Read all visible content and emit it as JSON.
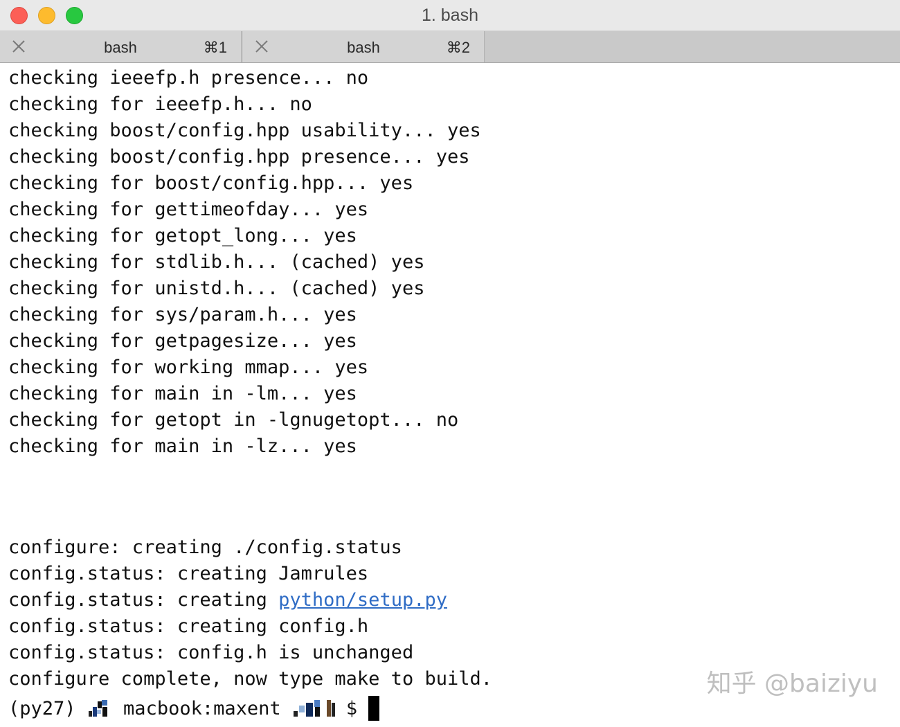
{
  "window": {
    "title": "1. bash"
  },
  "tabs": [
    {
      "label": "bash",
      "shortcut": "⌘1"
    },
    {
      "label": "bash",
      "shortcut": "⌘2"
    }
  ],
  "terminal": {
    "lines": [
      "checking ieeefp.h presence... no",
      "checking for ieeefp.h... no",
      "checking boost/config.hpp usability... yes",
      "checking boost/config.hpp presence... yes",
      "checking for boost/config.hpp... yes",
      "checking for gettimeofday... yes",
      "checking for getopt_long... yes",
      "checking for stdlib.h... (cached) yes",
      "checking for unistd.h... (cached) yes",
      "checking for sys/param.h... yes",
      "checking for getpagesize... yes",
      "checking for working mmap... yes",
      "checking for main in -lm... yes",
      "checking for getopt in -lgnugetopt... no",
      "checking for main in -lz... yes"
    ],
    "config_lines": [
      "configure: creating ./config.status",
      "config.status: creating Jamrules"
    ],
    "setup_prefix": "config.status: creating ",
    "setup_link": "python/setup.py",
    "config_lines_2": [
      "config.status: creating config.h",
      "config.status: config.h is unchanged",
      "configure complete, now type make to build."
    ],
    "prompt": {
      "env": "(py27) ",
      "host": " macbook:maxent ",
      "symbol": "$ "
    }
  },
  "watermark": "知乎 @baiziyu",
  "colors": {
    "link": "#2f6cc5",
    "close": "#fc5f57",
    "minimize": "#fdbb2e",
    "zoom": "#28c840"
  }
}
